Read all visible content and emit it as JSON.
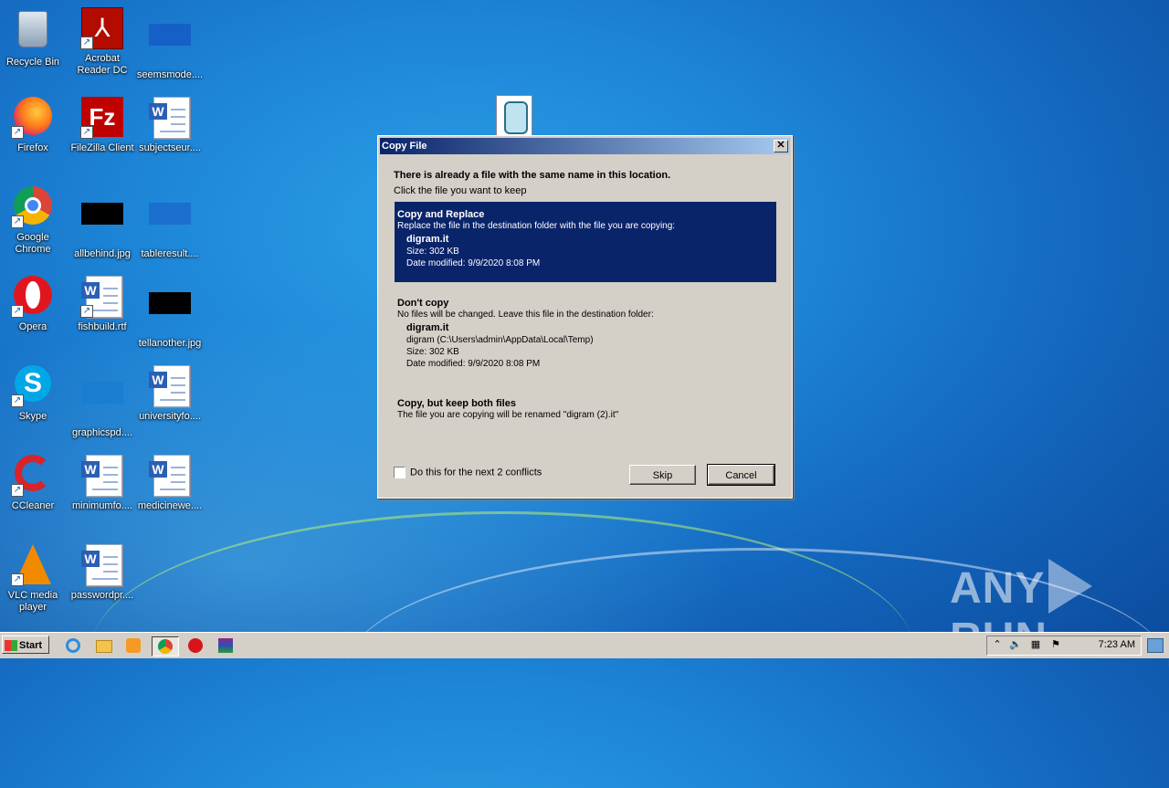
{
  "desktop": {
    "icons": [
      {
        "label": "Recycle Bin",
        "icon": "recycle-bin-icon"
      },
      {
        "label": "Acrobat Reader DC",
        "icon": "acrobat-icon"
      },
      {
        "label": "seemsmode....",
        "icon": "file-icon"
      },
      {
        "label": "Firefox",
        "icon": "firefox-icon"
      },
      {
        "label": "FileZilla Client",
        "icon": "filezilla-icon"
      },
      {
        "label": "subjectseur....",
        "icon": "word-doc-icon"
      },
      {
        "label": "Google Chrome",
        "icon": "chrome-icon"
      },
      {
        "label": "allbehind.jpg",
        "icon": "image-file-icon"
      },
      {
        "label": "tableresult....",
        "icon": "file-icon"
      },
      {
        "label": "Opera",
        "icon": "opera-icon"
      },
      {
        "label": "fishbuild.rtf",
        "icon": "word-doc-icon"
      },
      {
        "label": "tellanother.jpg",
        "icon": "image-file-icon"
      },
      {
        "label": "Skype",
        "icon": "skype-icon"
      },
      {
        "label": "graphicspd....",
        "icon": "file-icon"
      },
      {
        "label": "universityfo....",
        "icon": "word-doc-icon"
      },
      {
        "label": "CCleaner",
        "icon": "ccleaner-icon"
      },
      {
        "label": "minimumfo....",
        "icon": "word-doc-icon"
      },
      {
        "label": "medicinewe....",
        "icon": "word-doc-icon"
      },
      {
        "label": "VLC media player",
        "icon": "vlc-icon"
      },
      {
        "label": "passwordpr....",
        "icon": "word-doc-icon"
      }
    ]
  },
  "dialog": {
    "title": "Copy File",
    "close_label": "✕",
    "heading": "There is already a file with the same name in this location.",
    "subheading": "Click the file you want to keep",
    "option_replace": {
      "title": "Copy and Replace",
      "description": "Replace the file in the destination folder with the file you are copying:",
      "file_name": "digram.it",
      "size": "Size: 302 KB",
      "modified": "Date modified: 9/9/2020 8:08 PM"
    },
    "option_dont_copy": {
      "title": "Don't copy",
      "description": "No files will be changed. Leave this file in the destination folder:",
      "file_name": "digram.it",
      "location": "digram (C:\\Users\\admin\\AppData\\Local\\Temp)",
      "size": "Size: 302 KB",
      "modified": "Date modified: 9/9/2020 8:08 PM"
    },
    "option_keep_both": {
      "title": "Copy, but keep both files",
      "description": "The file you are copying will be renamed \"digram (2).it\""
    },
    "checkbox_label": "Do this for the next 2 conflicts",
    "skip_label": "Skip",
    "cancel_label": "Cancel"
  },
  "taskbar": {
    "start_label": "Start",
    "clock": "7:23 AM"
  },
  "watermark": {
    "left": "ANY",
    "right": "RUN"
  }
}
